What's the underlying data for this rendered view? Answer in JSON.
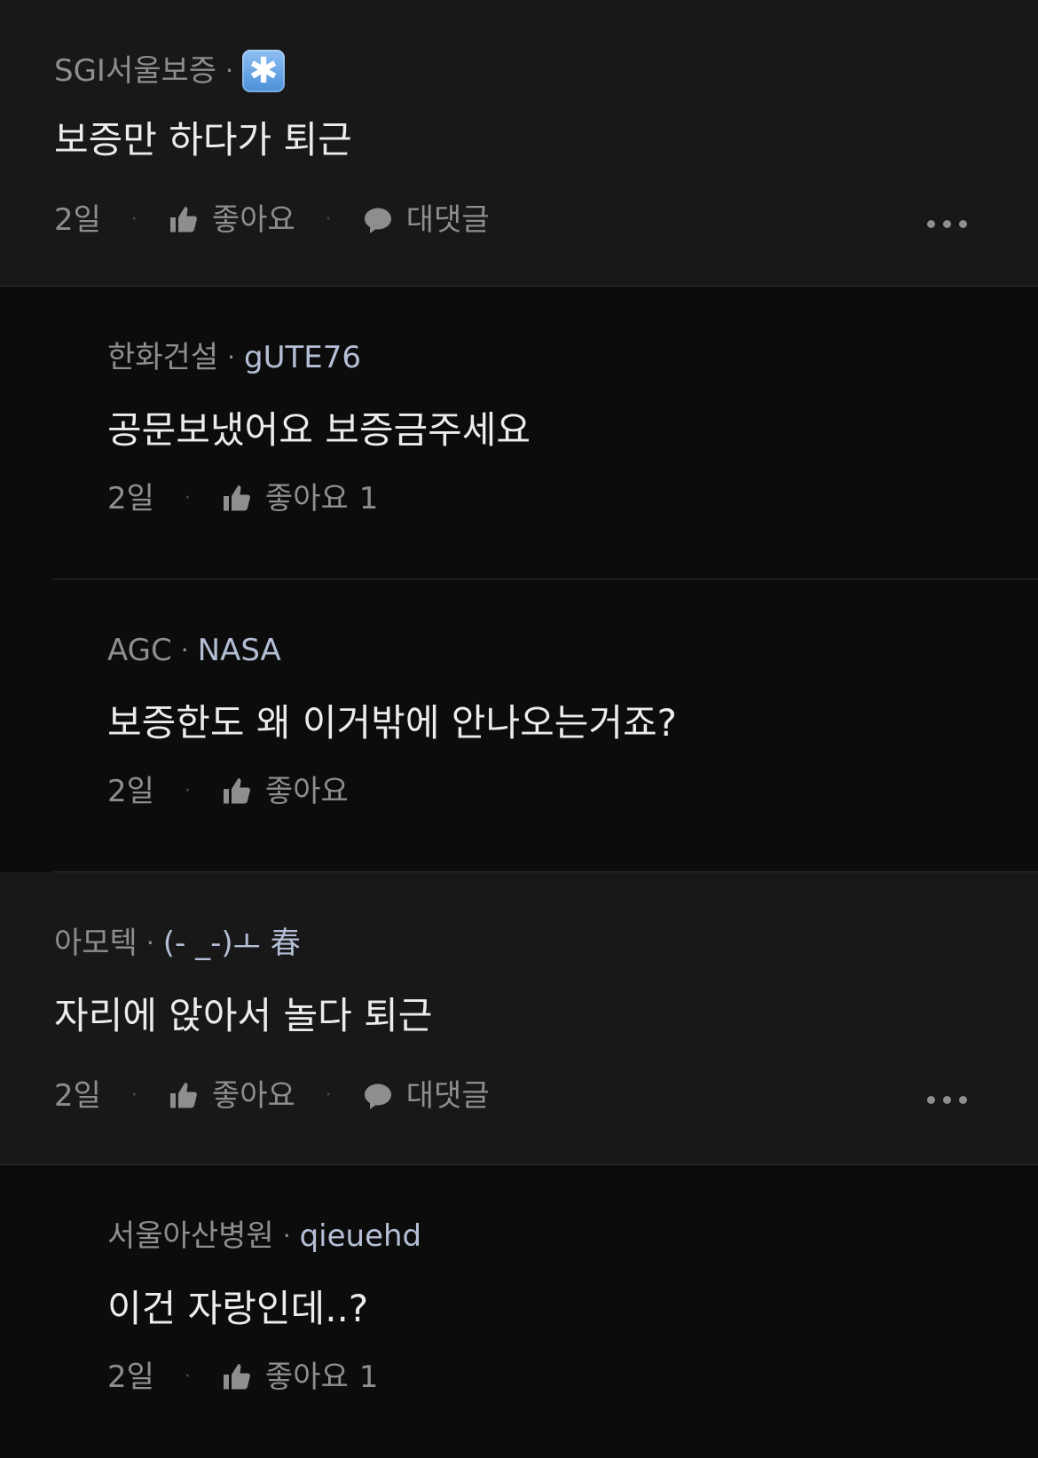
{
  "comments": [
    {
      "company": "SGI서울보증",
      "nickname_icon": "asterisk-emoji-icon",
      "nickname_glyph": "✱",
      "text": "보증만 하다가 퇴근",
      "time": "2일",
      "like_label": "좋아요",
      "reply_label": "대댓글",
      "replies": [
        {
          "company": "한화건설",
          "nickname": "gUTE76",
          "text": "공문보냈어요 보증금주세요",
          "time": "2일",
          "like_label": "좋아요",
          "like_count": "1"
        },
        {
          "company": "AGC",
          "nickname": "NASA",
          "text": "보증한도 왜 이거밖에 안나오는거죠?",
          "time": "2일",
          "like_label": "좋아요",
          "like_count": ""
        }
      ]
    },
    {
      "company": "아모텍",
      "nickname": "(- _-)ㅗ 春",
      "text": "자리에 앉아서 놀다 퇴근",
      "time": "2일",
      "like_label": "좋아요",
      "reply_label": "대댓글",
      "replies": [
        {
          "company": "서울아산병원",
          "nickname": "qieuehd",
          "text": "이건 자랑인데..?",
          "time": "2일",
          "like_label": "좋아요",
          "like_count": "1"
        }
      ]
    }
  ],
  "colors": {
    "background": "#0c0c0c",
    "comment_background": "#181818",
    "nickname": "#b4bfd6",
    "muted": "#8e8e8e"
  }
}
